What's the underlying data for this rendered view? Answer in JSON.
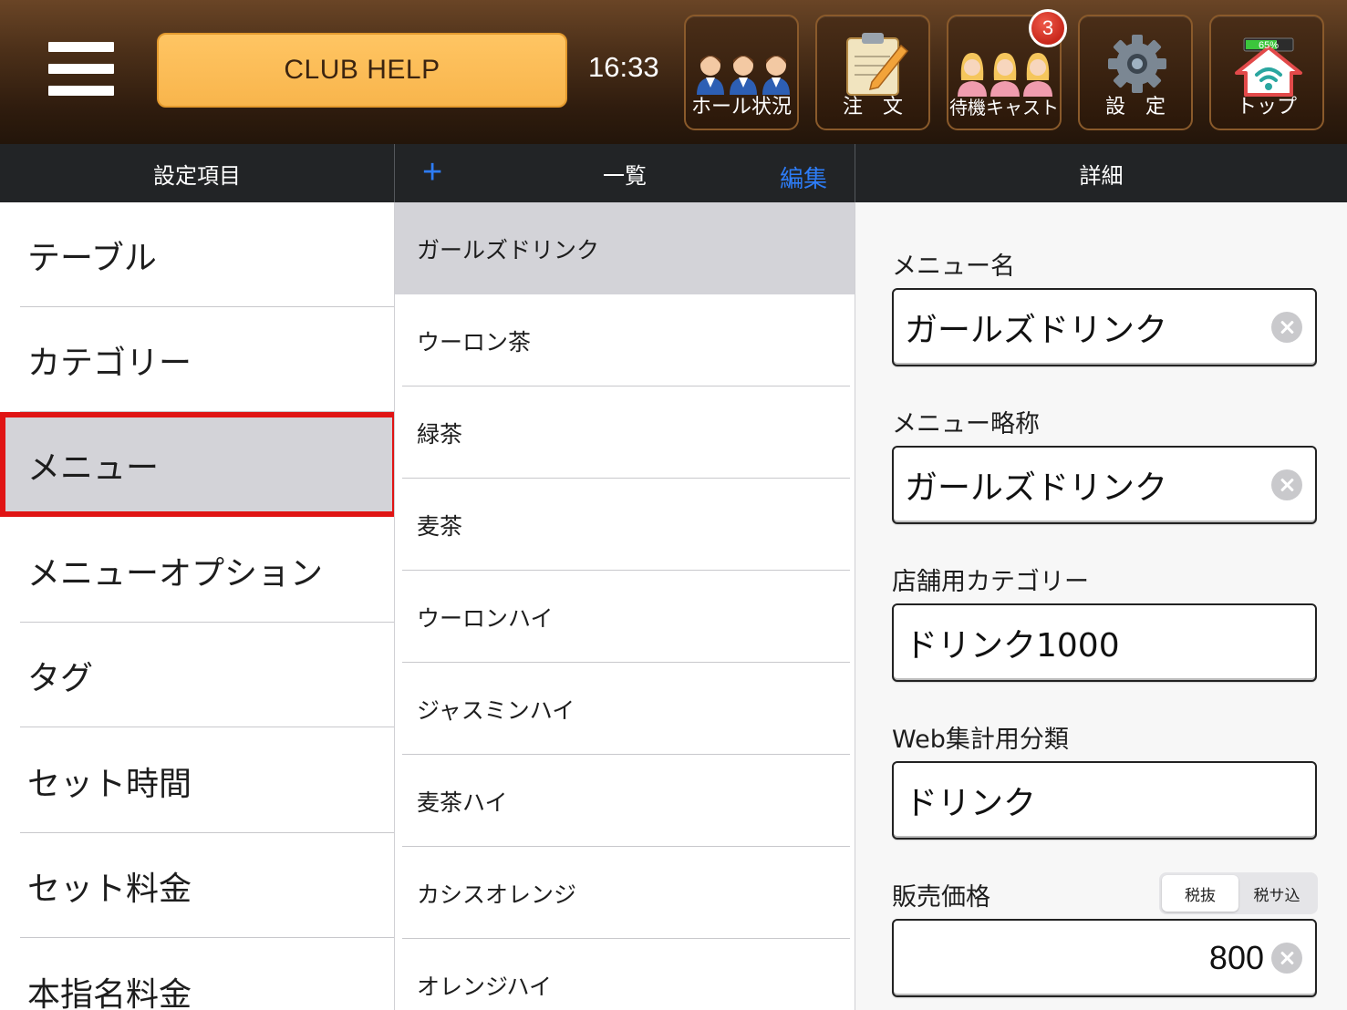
{
  "topbar": {
    "menu_icon": "hamburger-icon",
    "club_help_label": "CLUB HELP",
    "time": "16:33",
    "buttons": [
      {
        "label": "ホール状況",
        "icon": "staff-group-icon"
      },
      {
        "label": "注　文",
        "icon": "order-clipboard-icon"
      },
      {
        "label": "待機キャスト",
        "icon": "cast-group-icon",
        "badge": "3"
      },
      {
        "label": "設　定",
        "icon": "gear-icon"
      },
      {
        "label": "トップ",
        "icon": "home-wifi-icon",
        "battery": "65%"
      }
    ]
  },
  "headers": {
    "settings": "設定項目",
    "list": "一覧",
    "add": "+",
    "edit": "編集",
    "detail": "詳細"
  },
  "settings_items": [
    {
      "label": "テーブル",
      "selected": false
    },
    {
      "label": "カテゴリー",
      "selected": false
    },
    {
      "label": "メニュー",
      "selected": true
    },
    {
      "label": "メニューオプション",
      "selected": false
    },
    {
      "label": "タグ",
      "selected": false
    },
    {
      "label": "セット時間",
      "selected": false
    },
    {
      "label": "セット料金",
      "selected": false
    },
    {
      "label": "本指名料金",
      "selected": false
    }
  ],
  "list_items": [
    {
      "label": "ガールズドリンク",
      "selected": true
    },
    {
      "label": "ウーロン茶",
      "selected": false
    },
    {
      "label": "緑茶",
      "selected": false
    },
    {
      "label": "麦茶",
      "selected": false
    },
    {
      "label": "ウーロンハイ",
      "selected": false
    },
    {
      "label": "ジャスミンハイ",
      "selected": false
    },
    {
      "label": "麦茶ハイ",
      "selected": false
    },
    {
      "label": "カシスオレンジ",
      "selected": false
    },
    {
      "label": "オレンジハイ",
      "selected": false
    }
  ],
  "detail": {
    "menu_name_label": "メニュー名",
    "menu_name_value": "ガールズドリンク",
    "short_name_label": "メニュー略称",
    "short_name_value": "ガールズドリンク",
    "store_category_label": "店舗用カテゴリー",
    "store_category_value": "ドリンク1000",
    "web_category_label": "Web集計用分類",
    "web_category_value": "ドリンク",
    "price_label": "販売価格",
    "tax_options": [
      "税抜",
      "税サ込"
    ],
    "tax_selected": "税抜",
    "price_value": "800"
  },
  "colors": {
    "accent_blue": "#2d7cf6",
    "selection_red": "#e01414",
    "club_help_orange": "#f8b54c",
    "selected_gray": "#d3d3d8"
  }
}
